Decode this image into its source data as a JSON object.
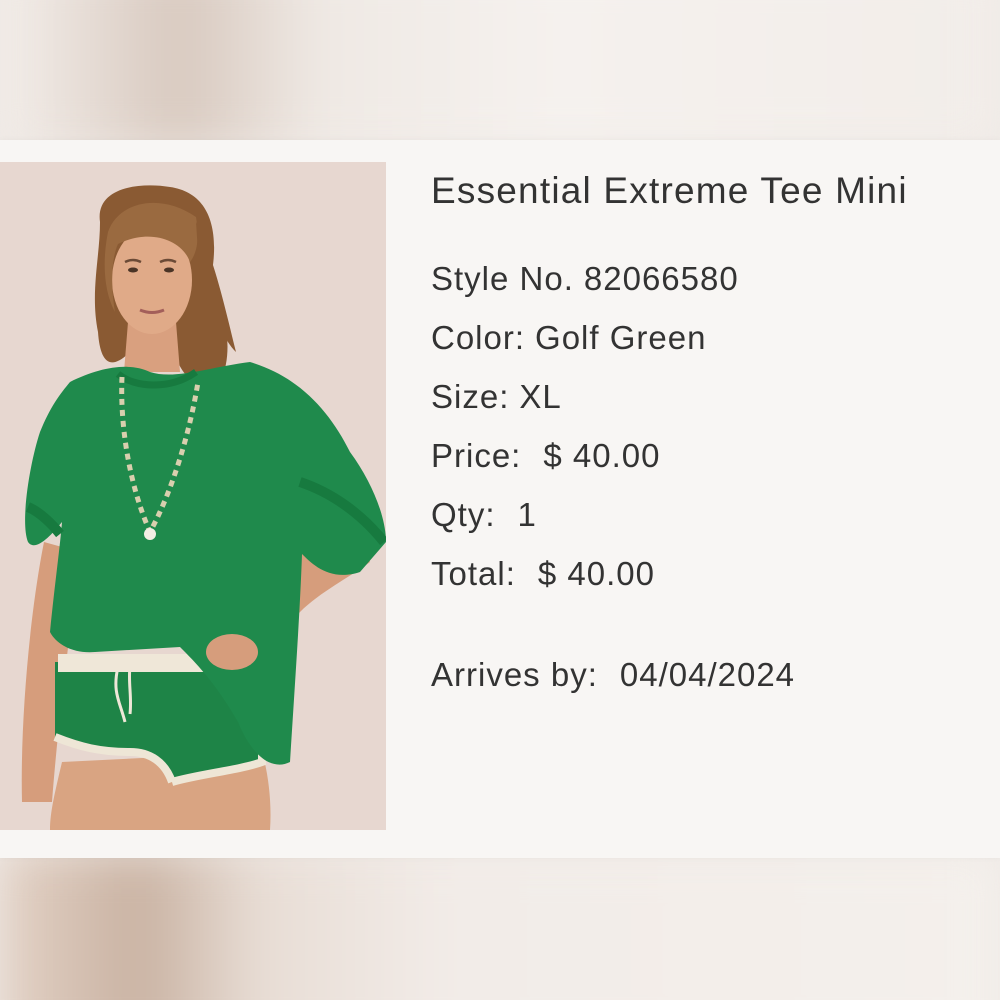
{
  "product": {
    "title": "Essential Extreme Tee Mini",
    "style_label": "Style No.",
    "style_value": "82066580",
    "color_label": "Color:",
    "color_value": "Golf Green",
    "size_label": "Size:",
    "size_value": "XL",
    "price_label": "Price:",
    "price_value": "$ 40.00",
    "qty_label": "Qty:",
    "qty_value": "1",
    "total_label": "Total:",
    "total_value": "$ 40.00",
    "arrives_label": "Arrives by:",
    "arrives_value": "04/04/2024"
  },
  "colors": {
    "text": "#333333",
    "card_bg": "#f8f6f4",
    "tee_green": "#1f8a4c"
  },
  "image": {
    "subject": "product-photo"
  }
}
